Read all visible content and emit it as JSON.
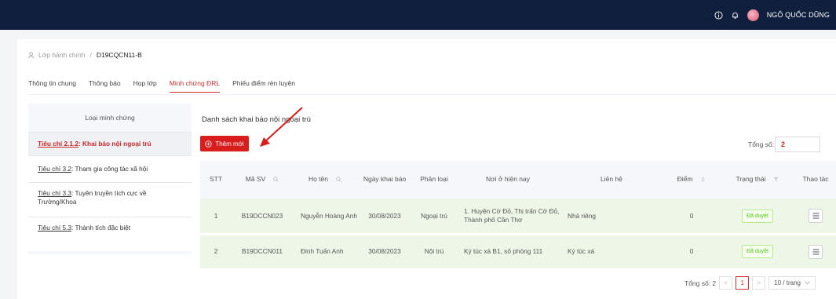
{
  "header": {
    "username": "NGÔ QUỐC DŨNG",
    "icons": [
      "info-icon",
      "bell-icon",
      "avatar"
    ]
  },
  "breadcrumb": {
    "root": "Lớp hành chính",
    "separator": "/",
    "current": "D19CQCN11-B"
  },
  "tabs": [
    {
      "label": "Thông tin chung",
      "active": false
    },
    {
      "label": "Thông báo",
      "active": false
    },
    {
      "label": "Họp lớp",
      "active": false
    },
    {
      "label": "Minh chứng ĐRL",
      "active": true
    },
    {
      "label": "Phiếu điểm rèn luyện",
      "active": false
    }
  ],
  "sidebar": {
    "header": "Loại minh chứng",
    "items": [
      {
        "code": "Tiêu chí 2.1.2",
        "text": ": Khai báo nội ngoại trú",
        "active": true
      },
      {
        "code": "Tiêu chí 3.2",
        "text": ": Tham gia công tác xã hội",
        "active": false
      },
      {
        "code": "Tiêu chí 3.3",
        "text": ": Tuyên truyền tích cực về Trường/Khoa",
        "active": false
      },
      {
        "code": "Tiêu chí 5.3",
        "text": ": Thành tích đặc biệt",
        "active": false
      }
    ]
  },
  "main": {
    "title": "Danh sách khai báo nội ngoại trú",
    "add_button": "Thêm mới",
    "total_label": "Tổng số:",
    "total_value": "2"
  },
  "table": {
    "columns": [
      "STT",
      "Mã SV",
      "Họ tên",
      "Ngày khai báo",
      "Phân loại",
      "Nơi ở hiện nay",
      "Liên hệ",
      "Điểm",
      "Trạng thái",
      "Thao tác"
    ],
    "rows": [
      {
        "stt": "1",
        "masv": "B19DCCN023",
        "hoten": "Nguyễn Hoàng Anh",
        "ngay": "30/08/2023",
        "phanloai": "Ngoại trú",
        "noio": "1. Huyện Cờ Đỏ, Thị trấn Cờ Đỏ, Thành phố Cần Thơ",
        "lienhe": "Nhà riêng",
        "diem": "0",
        "trangthai": "Đã duyệt"
      },
      {
        "stt": "2",
        "masv": "B19DCCN011",
        "hoten": "Đinh Tuấn Anh",
        "ngay": "30/08/2023",
        "phanloai": "Nội trú",
        "noio": "Ký túc xá B1, số phòng 111",
        "lienhe": "Ký túc xá",
        "diem": "0",
        "trangthai": "Đã duyệt"
      }
    ]
  },
  "pagination": {
    "total_text": "Tổng số: 2",
    "prev": "<",
    "current_page": "1",
    "next": ">",
    "page_size": "10 / trang"
  },
  "colors": {
    "topbar": "#0f1f3d",
    "accent": "#d91d1d",
    "row_bg": "#eef6e8",
    "status_green": "#52c41a"
  }
}
